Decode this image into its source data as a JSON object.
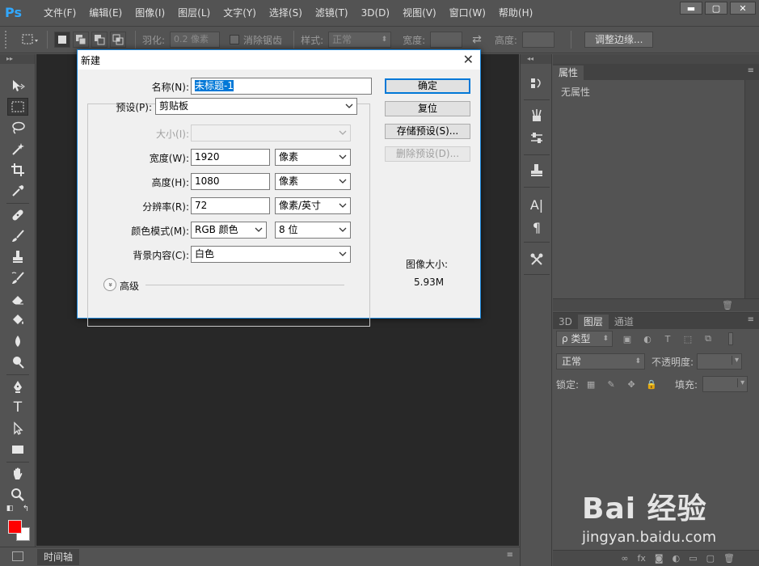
{
  "app": {
    "logo": "Ps",
    "menu": [
      "文件(F)",
      "编辑(E)",
      "图像(I)",
      "图层(L)",
      "文字(Y)",
      "选择(S)",
      "滤镜(T)",
      "3D(D)",
      "视图(V)",
      "窗口(W)",
      "帮助(H)"
    ],
    "window_buttons": {
      "minimize": "▬",
      "maximize": "▢",
      "close": "✕"
    }
  },
  "options": {
    "feather_label": "羽化:",
    "feather_value": "0.2 像素",
    "antialias_label": "消除锯齿",
    "style_label": "样式:",
    "style_value": "正常",
    "width_label": "宽度:",
    "height_label": "高度:",
    "refine_edge": "调整边缘..."
  },
  "timeline": {
    "tab": "时间轴",
    "menu_icon": "≡"
  },
  "properties_panel": {
    "tab": "属性",
    "empty_text": "无属性"
  },
  "layers_panel": {
    "tabs": [
      "3D",
      "图层",
      "通道"
    ],
    "active_tab": 1,
    "filter_label": "ρ 类型",
    "blend_mode": "正常",
    "opacity_label": "不透明度:",
    "lock_label": "锁定:",
    "fill_label": "填充:"
  },
  "dialog": {
    "title": "新建",
    "name_label": "名称(N):",
    "name_value": "未标题-1",
    "preset_label": "预设(P):",
    "preset_value": "剪贴板",
    "size_label": "大小(I):",
    "width_label": "宽度(W):",
    "width_value": "1920",
    "width_unit": "像素",
    "height_label": "高度(H):",
    "height_value": "1080",
    "height_unit": "像素",
    "resolution_label": "分辨率(R):",
    "resolution_value": "72",
    "resolution_unit": "像素/英寸",
    "color_mode_label": "颜色模式(M):",
    "color_mode_value": "RGB 颜色",
    "bit_depth_value": "8 位",
    "background_label": "背景内容(C):",
    "background_value": "白色",
    "advanced_label": "高级",
    "advanced_toggle": "»",
    "buttons": {
      "ok": "确定",
      "reset": "复位",
      "save_preset": "存储预设(S)...",
      "delete_preset": "删除预设(D)..."
    },
    "image_size_label": "图像大小:",
    "image_size_value": "5.93M"
  },
  "watermark": {
    "logo": "Bai 经验",
    "url": "jingyan.baidu.com"
  },
  "colors": {
    "foreground": "#ff0000",
    "background": "#ffffff",
    "accent": "#0078d7"
  }
}
